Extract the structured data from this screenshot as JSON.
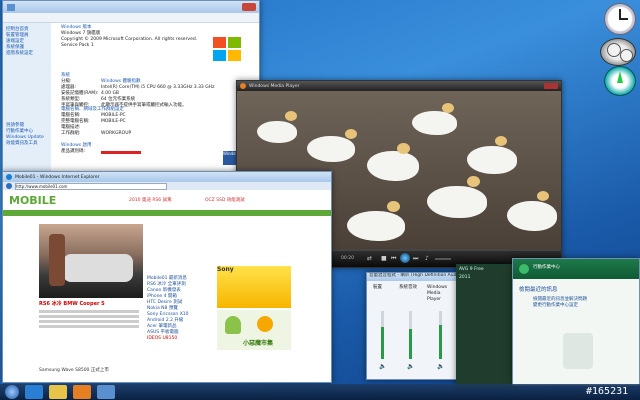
{
  "system": {
    "title": "Windows 版本",
    "edition": "Windows 7 旗艦版",
    "copyright": "Copyright © 2009 Microsoft Corporation. All rights reserved.",
    "service_pack": "Service Pack 1",
    "section_system": "系統",
    "labels": [
      "分級:",
      "處理器:",
      "安裝記憶體(RAM):",
      "系統類型:",
      "手寫筆與觸控:"
    ],
    "values": [
      "Windows 體驗指數",
      "Intel(R) Core(TM) i5 CPU 660 @ 3.33GHz 3.33 GHz",
      "4.00 GB",
      "64 位元作業系統",
      "此顯示器不提供手寫筆或觸控式輸入功能。"
    ],
    "section_computer": "電腦名稱、網域及工作群組設定",
    "computer_labels": [
      "電腦名稱:",
      "完整電腦名稱:",
      "電腦描述:",
      "工作群組:"
    ],
    "computer_values": [
      "MOBILE-PC",
      "MOBILE-PC",
      "",
      "WORKGROUP"
    ],
    "section_activation": "Windows 啟用",
    "activation_label": "產品識別碼:",
    "sidebar": [
      "控制台首頁",
      "裝置管理員",
      "遠端設定",
      "系統保護",
      "進階系統設定"
    ],
    "sidebar_bottom": [
      "另請參閱",
      "行動作業中心",
      "Windows Update",
      "效能資訊及工具"
    ],
    "brand": "Windows"
  },
  "player": {
    "title": "Windows Media Player",
    "time": "00:20"
  },
  "browser": {
    "title": "Mobile01 - Windows Internet Explorer",
    "url": "http://www.mobile01.com",
    "logo_text": "MOBILE",
    "banner1": "2010 奧迪 RS6 試駕",
    "banner2": "OCZ SSD 效能測試",
    "headline": "RS6 冰冷 BMW Cooper S",
    "sony_text": "Sony",
    "ideos_text": "IDEOS U8150",
    "market_text": "小惡魔市集",
    "bottom_text": "Samsung Wave S8500 正式上市",
    "news": [
      "Mobile01 最新消息",
      "RS6 冰冷 全車評測",
      "Canon 新機發表",
      "iPhone 4 開箱",
      "HTC Desire 測試",
      "Nokia N8 預覽",
      "Sony Ericsson X10",
      "Android 2.2 升級",
      "Acer 筆電新品",
      "ASUS 平板電腦"
    ]
  },
  "mixer": {
    "title": "音量混音程式 - 喇叭 (High Definition Audio)",
    "channels": [
      "裝置",
      "系統音效",
      "Windows Media Player"
    ]
  },
  "action_center": {
    "title": "行動作業中心",
    "heading": "檢閱最近的訊息",
    "items": [
      "檢閱最近的訊息並解決問題",
      "變更行動作業中心設定"
    ]
  },
  "audio_panel": {
    "title": "AVG 9 Free",
    "subtitle": "2011"
  },
  "watermark": "#165231",
  "colors": {
    "accent": "#1d6fc4",
    "green": "#1d8a3a"
  }
}
